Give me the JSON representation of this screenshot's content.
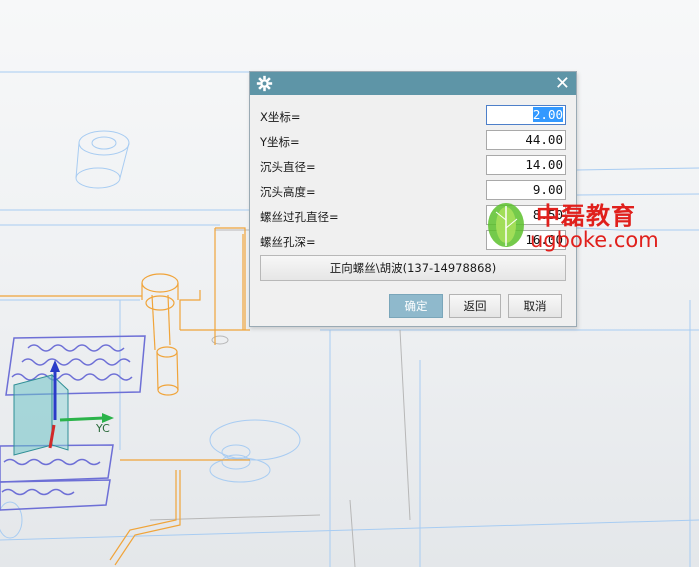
{
  "dialog": {
    "title": "",
    "fields": [
      {
        "label": "X坐标=",
        "value": "2.00",
        "selected": true
      },
      {
        "label": "Y坐标=",
        "value": "44.00",
        "selected": false
      },
      {
        "label": "沉头直径=",
        "value": "14.00",
        "selected": false
      },
      {
        "label": "沉头高度=",
        "value": "9.00",
        "selected": false
      },
      {
        "label": "螺丝过孔直径=",
        "value": "8.50",
        "selected": false
      },
      {
        "label": "螺丝孔深=",
        "value": "16.00",
        "selected": false
      }
    ],
    "wide_button": "正向螺丝\\胡波(137-14978868)",
    "ok_label": "确定",
    "back_label": "返回",
    "cancel_label": "取消"
  },
  "viewport": {
    "axis_label": "YC"
  },
  "watermark": {
    "brand": "中磊教育",
    "url": "ugboke.com"
  },
  "colors": {
    "title_bar": "#5e95a7",
    "ok_button": "#8fb9cc",
    "wireframe_blue": "#9fc6ef",
    "wireframe_orange": "#f0a43a",
    "watermark_red": "#e0201c"
  }
}
